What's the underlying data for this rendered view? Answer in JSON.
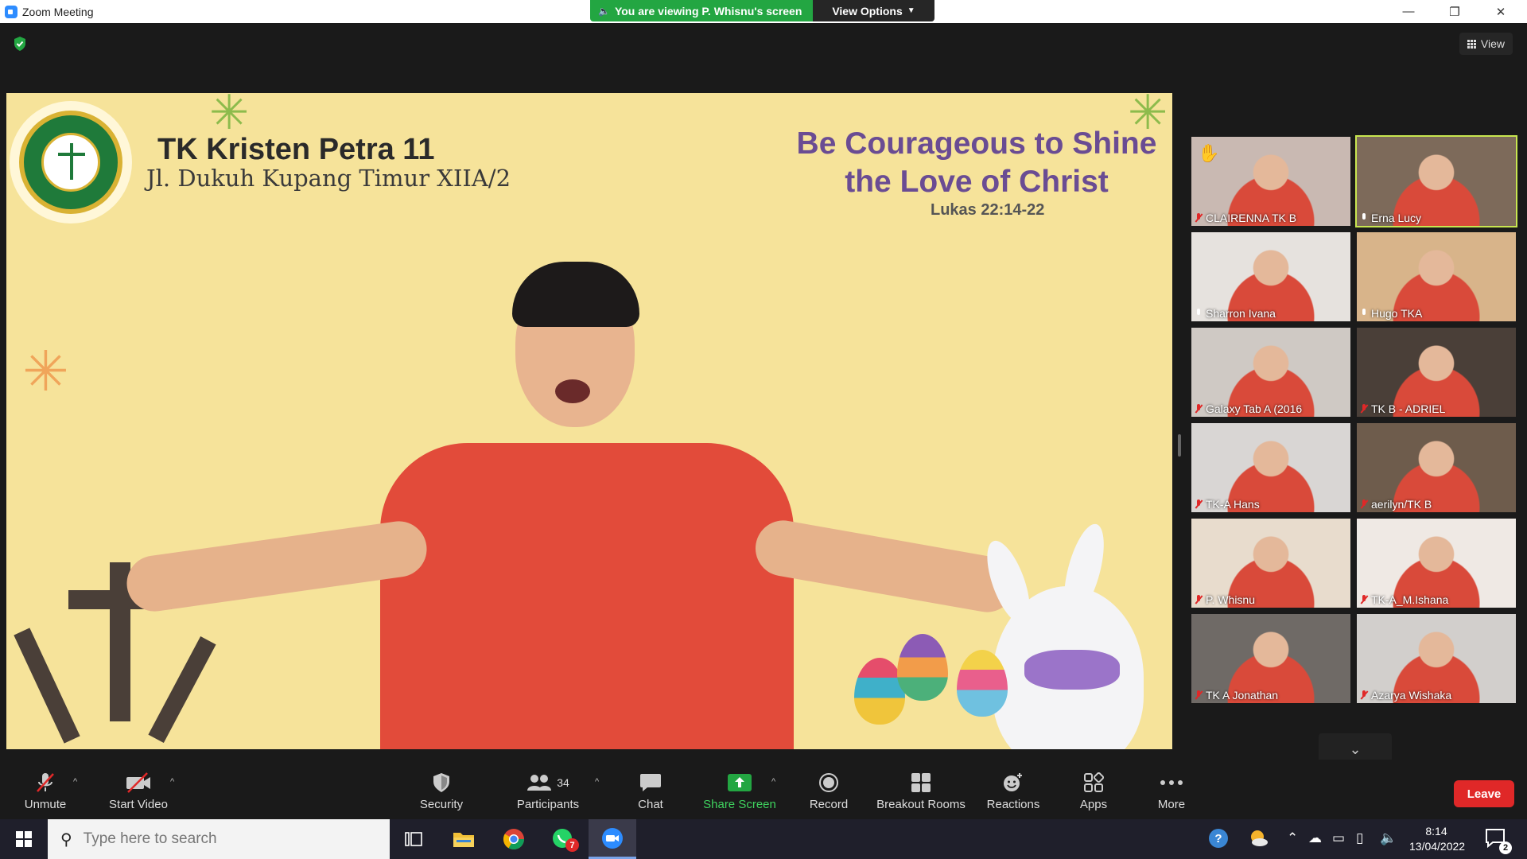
{
  "window": {
    "title": "Zoom Meeting",
    "viewing_banner": "You are viewing P. Whisnu's screen",
    "view_options_label": "View Options",
    "minimize": "—",
    "restore": "❐",
    "close": "✕"
  },
  "meeting": {
    "view_label": "View"
  },
  "shared_screen": {
    "school_name": "TK Kristen Petra 11",
    "school_address": "Jl. Dukuh Kupang Timur XIIA/2",
    "motto_line1": "Be Courageous to Shine",
    "motto_line2": "the Love of Christ",
    "verse": "Lukas 22:14-22"
  },
  "gallery": {
    "participants": [
      {
        "name": "CLAIRENNA TK B",
        "muted": true,
        "hand_raised": true,
        "active": false,
        "bg": "#c9b9b2"
      },
      {
        "name": "Erna Lucy",
        "muted": false,
        "hand_raised": false,
        "active": true,
        "bg": "#7d6a5a"
      },
      {
        "name": "Sharron Ivana",
        "muted": false,
        "hand_raised": false,
        "active": false,
        "bg": "#e6e2de"
      },
      {
        "name": "Hugo TKA",
        "muted": false,
        "hand_raised": false,
        "active": false,
        "bg": "#d8b48a"
      },
      {
        "name": "Galaxy Tab A (2016",
        "muted": true,
        "hand_raised": false,
        "active": false,
        "bg": "#cfc9c4"
      },
      {
        "name": "TK B - ADRIEL",
        "muted": true,
        "hand_raised": false,
        "active": false,
        "bg": "#4a3f38"
      },
      {
        "name": "TK-A Hans",
        "muted": true,
        "hand_raised": false,
        "active": false,
        "bg": "#d9d6d4"
      },
      {
        "name": "aerilyn/TK B",
        "muted": true,
        "hand_raised": false,
        "active": false,
        "bg": "#6e5c4c"
      },
      {
        "name": "P. Whisnu",
        "muted": true,
        "hand_raised": false,
        "active": false,
        "bg": "#e8dccd"
      },
      {
        "name": "TK-A_M.Ishana",
        "muted": true,
        "hand_raised": false,
        "active": false,
        "bg": "#efe9e4"
      },
      {
        "name": "TK A Jonathan",
        "muted": true,
        "hand_raised": false,
        "active": false,
        "bg": "#6f6a66"
      },
      {
        "name": "Azarya Wishaka",
        "muted": true,
        "hand_raised": false,
        "active": false,
        "bg": "#d2cfcc"
      }
    ],
    "scroll_down": "⌄"
  },
  "toolbar": {
    "unmute": "Unmute",
    "start_video": "Start Video",
    "security": "Security",
    "participants": "Participants",
    "participants_count": "34",
    "chat": "Chat",
    "share_screen": "Share Screen",
    "record": "Record",
    "breakout_rooms": "Breakout Rooms",
    "reactions": "Reactions",
    "apps": "Apps",
    "more": "More",
    "leave": "Leave",
    "caret": "^"
  },
  "taskbar": {
    "search_placeholder": "Type here to search",
    "time": "8:14",
    "date": "13/04/2022",
    "whatsapp_badge": "7",
    "notification_count": "2"
  },
  "colors": {
    "zoom_blue": "#2d8cff",
    "banner_green": "#23a642",
    "leave_red": "#e02828",
    "active_speaker": "#c8e650"
  }
}
